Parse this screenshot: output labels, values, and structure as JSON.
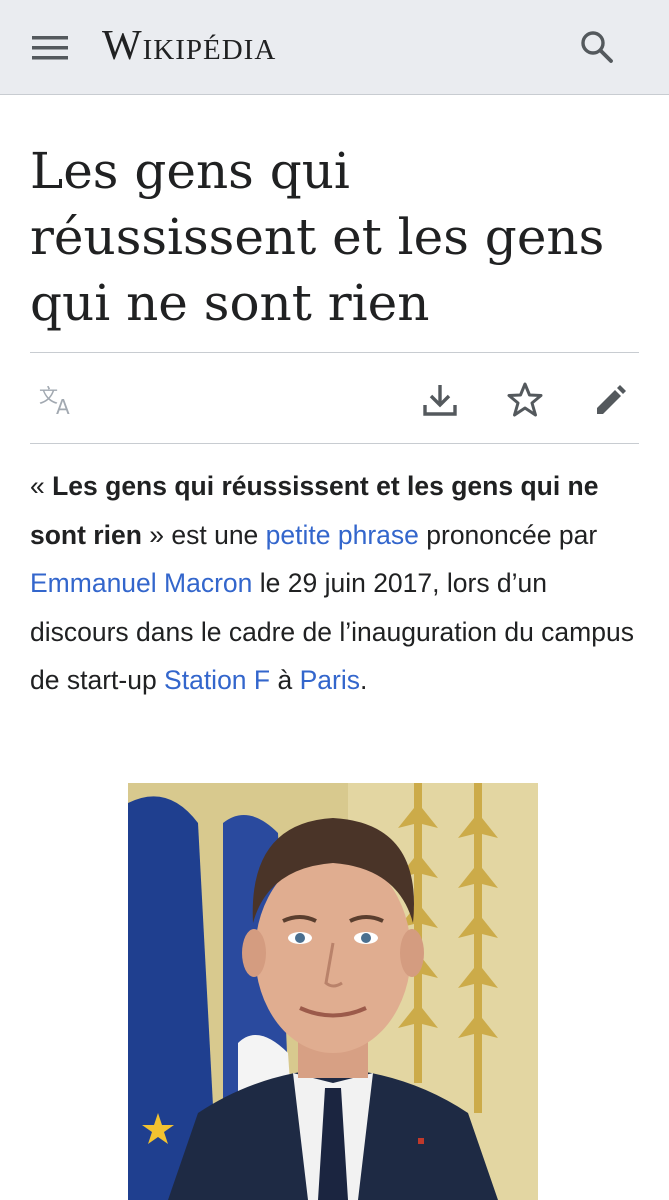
{
  "header": {
    "logo_text": "Wikipédia",
    "menu_icon": "hamburger-menu-icon",
    "search_icon": "search-icon"
  },
  "page": {
    "title": "Les gens qui réussissent et les gens qui ne sont rien"
  },
  "actions": {
    "language_icon": "translate-icon",
    "download_icon": "download-icon",
    "watch_icon": "star-icon",
    "edit_icon": "pencil-icon"
  },
  "lead": {
    "open_quote": "« ",
    "bold_phrase": "Les gens qui réussissent et les gens qui ne sont rien",
    "text_1": " » est une ",
    "link_petite_phrase": "petite phrase",
    "text_2": " prononcée par ",
    "link_macron": "Emmanuel Macron",
    "text_3": " le 29 juin 2017, lors d’un discours dans le cadre de l’inauguration du campus de start-up ",
    "link_station_f": "Station F",
    "text_4": " à ",
    "link_paris": "Paris",
    "text_5": "."
  },
  "colors": {
    "link": "#3366cc",
    "header_bg": "#eaecf0",
    "text": "#202122",
    "rule": "#c8ccd1"
  }
}
